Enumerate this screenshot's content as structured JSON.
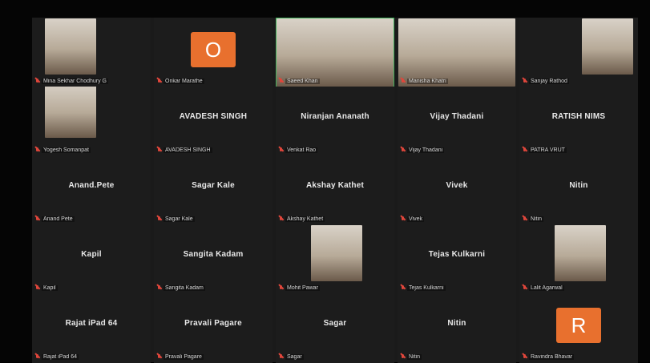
{
  "colors": {
    "background": "#1a1a1a",
    "tile": "#1c1c1c",
    "speaking_border": "#3fae5a",
    "muted_mic": "#e0463b",
    "avatar_orange": "#e8702e"
  },
  "participants": [
    {
      "name": "Mina Sekhar Chodhury G",
      "display": "",
      "video": true,
      "speaking": false
    },
    {
      "name": "Onkar Marathe",
      "display": "",
      "avatar": "O",
      "speaking": false
    },
    {
      "name": "Saeed Khan",
      "display": "",
      "video": true,
      "speaking": true
    },
    {
      "name": "Manisha Khatri",
      "display": "",
      "video": true,
      "speaking": false
    },
    {
      "name": "Sanjay Rathod",
      "display": "",
      "video": true,
      "speaking": false
    },
    {
      "name": "Yogesh Somanpat",
      "display": "",
      "video": true,
      "speaking": false
    },
    {
      "name": "AVADESH SINGH",
      "display": "AVADESH SINGH",
      "speaking": false
    },
    {
      "name": "Venkat Rao",
      "display": "Niranjan Ananath",
      "speaking": false
    },
    {
      "name": "Vijay Thadani",
      "display": "Vijay Thadani",
      "speaking": false
    },
    {
      "name": "PATRA VRUT",
      "display": "RATISH NIMS",
      "speaking": false
    },
    {
      "name": "Anand Pete",
      "display": "Anand.Pete",
      "speaking": false
    },
    {
      "name": "Sagar Kale",
      "display": "Sagar Kale",
      "speaking": false
    },
    {
      "name": "Akshay Kathet",
      "display": "Akshay Kathet",
      "speaking": false
    },
    {
      "name": "Vivek",
      "display": "Vivek",
      "speaking": false
    },
    {
      "name": "Nitin",
      "display": "Nitin",
      "speaking": false
    },
    {
      "name": "Kapil",
      "display": "Kapil",
      "speaking": false
    },
    {
      "name": "Sangita Kadam",
      "display": "Sangita Kadam",
      "speaking": false
    },
    {
      "name": "Mohit Pawar",
      "display": "",
      "video": true,
      "speaking": false
    },
    {
      "name": "Tejas Kulkarni",
      "display": "Tejas Kulkarni",
      "speaking": false
    },
    {
      "name": "Lalit Agarwal",
      "display": "",
      "video": true,
      "speaking": false
    },
    {
      "name": "Rajat iPad 64",
      "display": "Rajat iPad 64",
      "speaking": false
    },
    {
      "name": "Pravali Pagare",
      "display": "Pravali Pagare",
      "speaking": false
    },
    {
      "name": "Sagar",
      "display": "Sagar",
      "speaking": false
    },
    {
      "name": "Nitin",
      "display": "Nitin",
      "speaking": false
    },
    {
      "name": "Ravindra Bhavar",
      "display": "",
      "avatar": "R",
      "speaking": false
    }
  ]
}
